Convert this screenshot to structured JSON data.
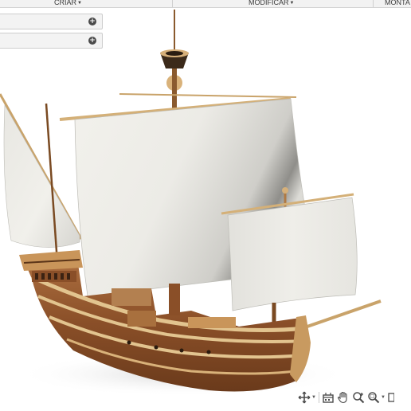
{
  "toolbar": {
    "menus": [
      {
        "label": "CRIAR"
      },
      {
        "label": "MODIFICAR"
      },
      {
        "label": "MONTA"
      }
    ]
  },
  "browser": {
    "rows": [
      {
        "action_icon": "add-icon"
      },
      {
        "action_icon": "add-icon"
      }
    ]
  },
  "viewport": {
    "model": "caravel-sailing-ship",
    "colors": {
      "hull_dark": "#7a4522",
      "hull_light": "#b07242",
      "trim": "#e2c48f",
      "sail": "#ecebe6",
      "sail_shadow": "#9a9994",
      "mast": "#8a5a2e",
      "background": "#ffffff"
    }
  },
  "navigation": {
    "tools": [
      {
        "icon": "orbit-icon",
        "has_dropdown": true
      },
      {
        "icon": "look-at-icon",
        "has_dropdown": false
      },
      {
        "icon": "pan-hand-icon",
        "has_dropdown": false
      },
      {
        "icon": "zoom-icon",
        "has_dropdown": false
      },
      {
        "icon": "zoom-window-icon",
        "has_dropdown": true
      },
      {
        "icon": "display-settings-icon",
        "has_dropdown": false
      }
    ]
  }
}
